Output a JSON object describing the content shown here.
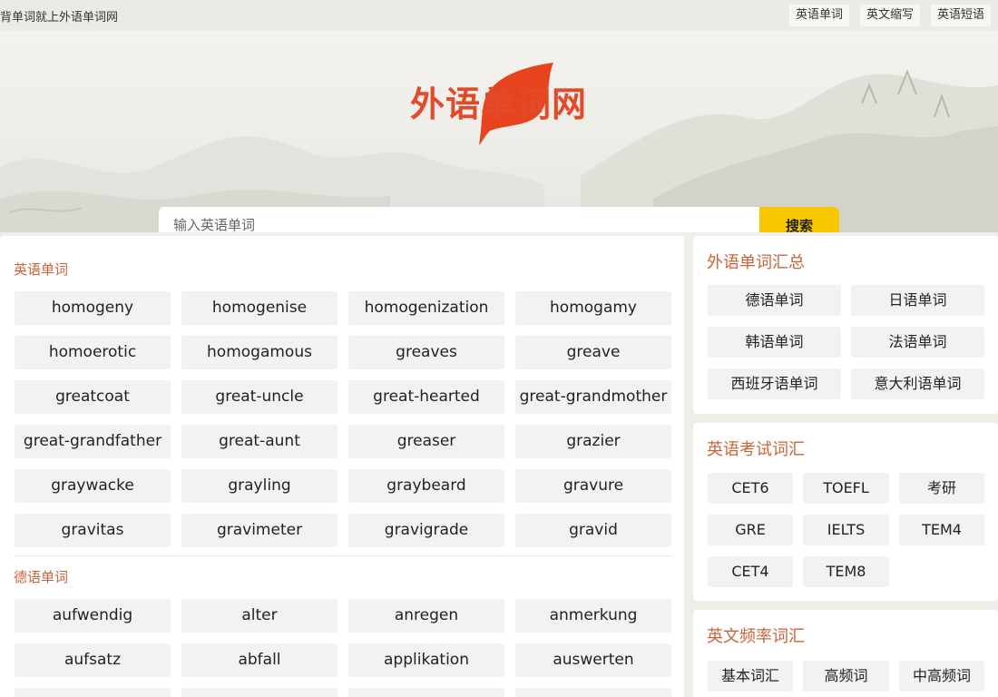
{
  "topbar": {
    "slogan": "背单词就上外语单词网",
    "nav": [
      "英语单词",
      "英文缩写",
      "英语短语"
    ]
  },
  "logo": {
    "text": "外语单词网"
  },
  "search": {
    "placeholder": "输入英语单词",
    "button_label": "搜索"
  },
  "english_section": {
    "title": "英语单词",
    "words": [
      "homogeny",
      "homogenise",
      "homogenization",
      "homogamy",
      "homoerotic",
      "homogamous",
      "greaves",
      "greave",
      "greatcoat",
      "great-uncle",
      "great-hearted",
      "great-grandmother",
      "great-grandfather",
      "great-aunt",
      "greaser",
      "grazier",
      "graywacke",
      "grayling",
      "graybeard",
      "gravure",
      "gravitas",
      "gravimeter",
      "gravigrade",
      "gravid"
    ]
  },
  "german_section": {
    "title": "德语单词",
    "words": [
      "aufwendig",
      "alter",
      "anregen",
      "anmerkung",
      "aufsatz",
      "abfall",
      "applikation",
      "auswerten"
    ]
  },
  "sidebar": {
    "foreign": {
      "title": "外语单词汇总",
      "items": [
        "德语单词",
        "日语单词",
        "韩语单词",
        "法语单词",
        "西班牙语单词",
        "意大利语单词"
      ]
    },
    "exams": {
      "title": "英语考试词汇",
      "items": [
        "CET6",
        "TOEFL",
        "考研",
        "GRE",
        "IELTS",
        "TEM4",
        "CET4",
        "TEM8"
      ]
    },
    "frequency": {
      "title": "英文频率词汇",
      "items": [
        "基本词汇",
        "高频词",
        "中高频词"
      ]
    }
  },
  "colors": {
    "accent": "#c8643b",
    "search_button": "#f9c700",
    "logo_red": "#e34a2a"
  }
}
